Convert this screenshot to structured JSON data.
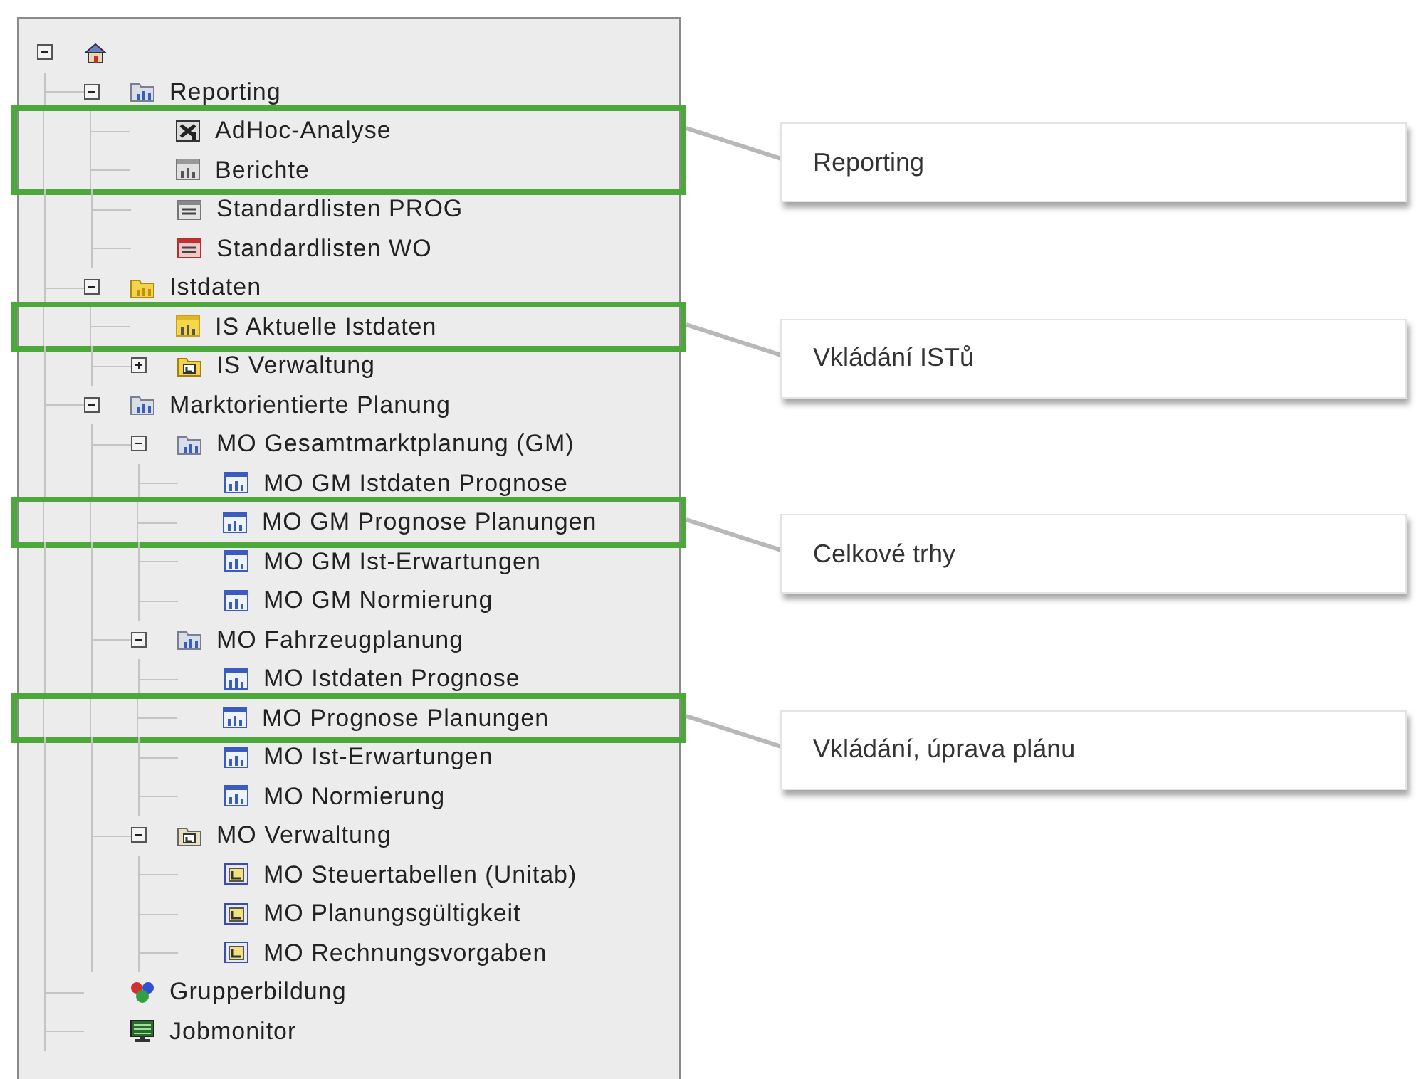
{
  "tree": [
    {
      "kind": "home",
      "expanded": true,
      "highlighted": false,
      "children": [
        {
          "label": "Reporting",
          "kind": "folder",
          "expanded": true,
          "highlighted": false,
          "children": [
            {
              "label": "AdHoc-Analyse",
              "kind": "adhoc",
              "highlighted": true
            },
            {
              "label": "Berichte",
              "kind": "report",
              "highlighted": true
            },
            {
              "label": "Standardlisten PROG",
              "kind": "list",
              "highlighted": false
            },
            {
              "label": "Standardlisten WO",
              "kind": "list-red",
              "highlighted": false
            }
          ]
        },
        {
          "label": "Istdaten",
          "kind": "folder-yellow",
          "expanded": true,
          "highlighted": false,
          "children": [
            {
              "label": "IS Aktuelle Istdaten",
              "kind": "report-yellow",
              "highlighted": true
            },
            {
              "label": "IS Verwaltung",
              "kind": "admin-yellow",
              "expanded": false,
              "highlighted": false
            }
          ]
        },
        {
          "label": "Marktorientierte Planung",
          "kind": "folder",
          "expanded": true,
          "highlighted": false,
          "children": [
            {
              "label": "MO Gesamtmarktplanung (GM)",
              "kind": "folder",
              "expanded": true,
              "highlighted": false,
              "children": [
                {
                  "label": "MO GM Istdaten Prognose",
                  "kind": "chart",
                  "highlighted": false
                },
                {
                  "label": "MO GM Prognose Planungen",
                  "kind": "chart",
                  "highlighted": true
                },
                {
                  "label": "MO GM Ist-Erwartungen",
                  "kind": "chart",
                  "highlighted": false
                },
                {
                  "label": "MO GM Normierung",
                  "kind": "chart",
                  "highlighted": false
                }
              ]
            },
            {
              "label": "MO Fahrzeugplanung",
              "kind": "folder",
              "expanded": true,
              "highlighted": false,
              "children": [
                {
                  "label": "MO Istdaten Prognose",
                  "kind": "chart",
                  "highlighted": false
                },
                {
                  "label": "MO Prognose Planungen",
                  "kind": "chart",
                  "highlighted": true
                },
                {
                  "label": "MO Ist-Erwartungen",
                  "kind": "chart",
                  "highlighted": false
                },
                {
                  "label": "MO Normierung",
                  "kind": "chart",
                  "highlighted": false
                }
              ]
            },
            {
              "label": "MO Verwaltung",
              "kind": "admin",
              "expanded": true,
              "highlighted": false,
              "children": [
                {
                  "label": "MO Steuertabellen (Unitab)",
                  "kind": "admin-report",
                  "highlighted": false
                },
                {
                  "label": "MO Planungsgültigkeit",
                  "kind": "admin-report",
                  "highlighted": false
                },
                {
                  "label": "MO Rechnungsvorgaben",
                  "kind": "admin-report",
                  "highlighted": false
                }
              ]
            }
          ]
        },
        {
          "label": "Grupperbildung",
          "kind": "groups",
          "highlighted": false
        },
        {
          "label": "Jobmonitor",
          "kind": "monitor",
          "highlighted": false
        }
      ]
    }
  ],
  "callouts": [
    "Reporting",
    "Vkládání ISTů",
    "Celkové trhy",
    "Vkládání, úprava plánu"
  ]
}
